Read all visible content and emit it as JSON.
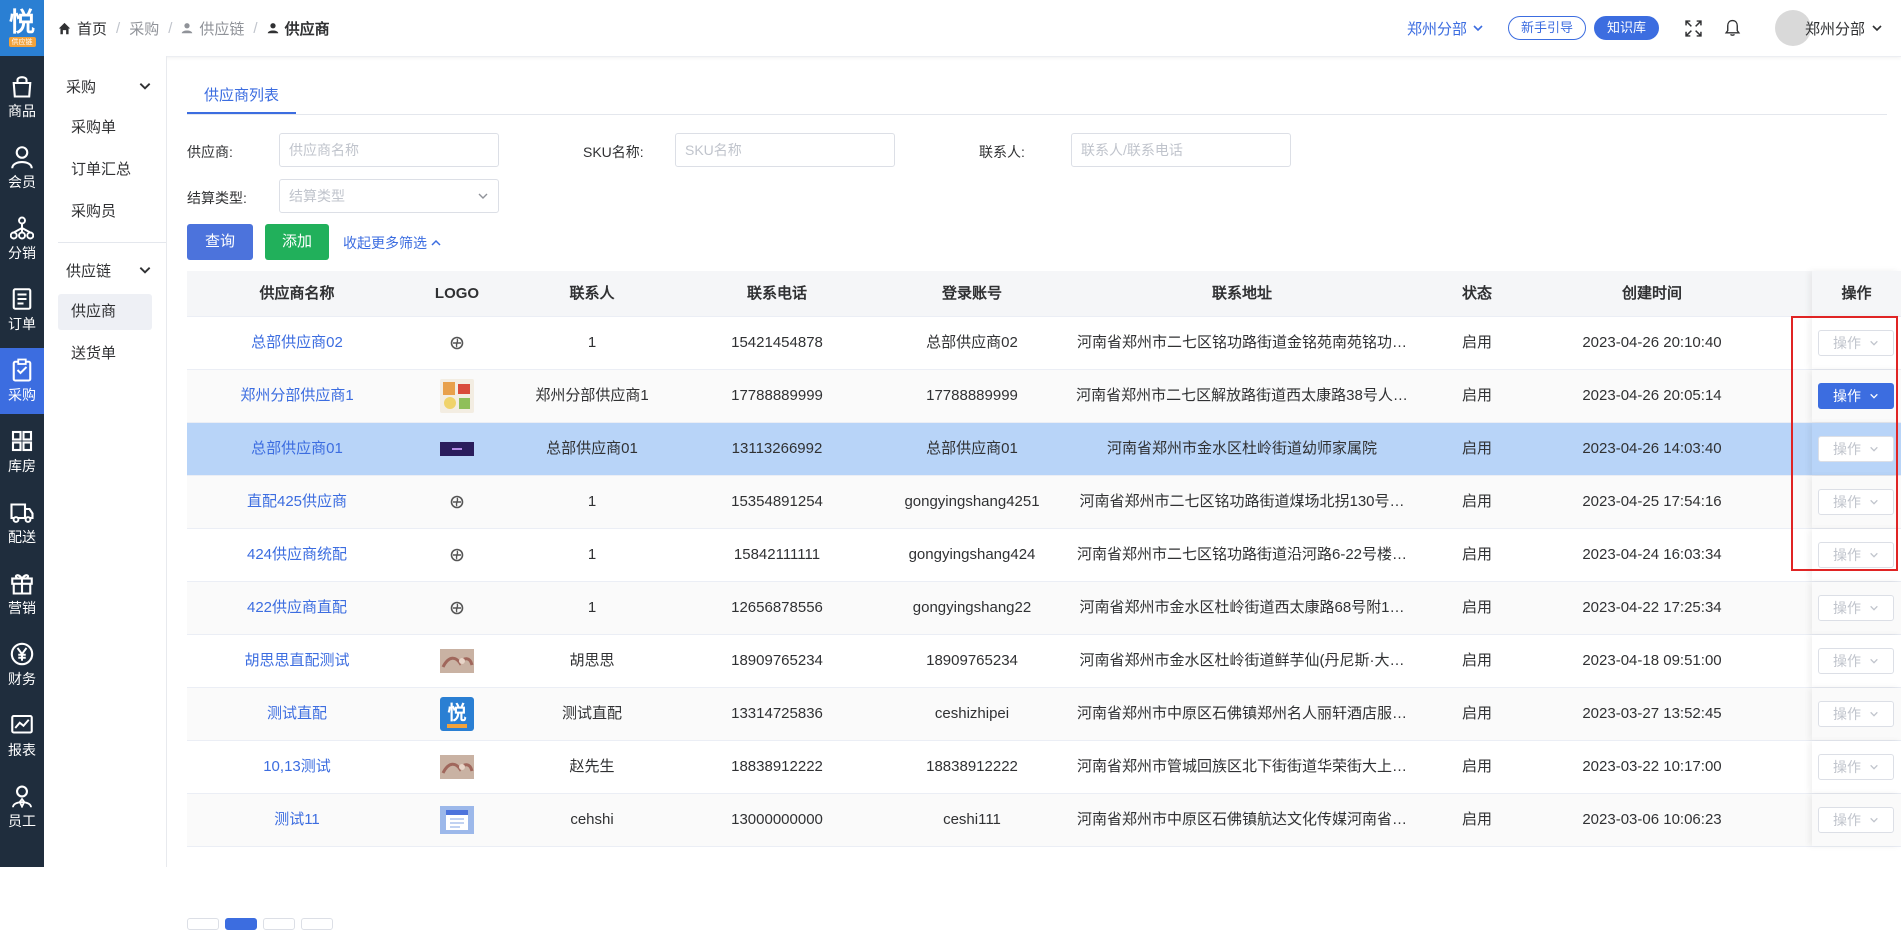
{
  "brand": {
    "logo_text": "悦",
    "logo_sub": "供应链"
  },
  "breadcrumb": [
    "首页",
    "采购",
    "供应链",
    "供应商"
  ],
  "header": {
    "branch": "郑州分部",
    "guide_label": "新手引导",
    "kb_label": "知识库",
    "user_name": "郑州分部"
  },
  "rail": [
    {
      "label": "商品",
      "icon": "bag-icon"
    },
    {
      "label": "会员",
      "icon": "user-icon"
    },
    {
      "label": "分销",
      "icon": "network-icon"
    },
    {
      "label": "订单",
      "icon": "document-icon"
    },
    {
      "label": "采购",
      "icon": "clipboard-icon",
      "active": true
    },
    {
      "label": "库房",
      "icon": "grid-icon"
    },
    {
      "label": "配送",
      "icon": "truck-icon"
    },
    {
      "label": "营销",
      "icon": "gift-icon"
    },
    {
      "label": "财务",
      "icon": "yen-icon"
    },
    {
      "label": "报表",
      "icon": "chart-icon"
    },
    {
      "label": "员工",
      "icon": "employee-icon"
    }
  ],
  "subnav": {
    "group1": "采购",
    "group1_items": [
      "采购单",
      "订单汇总",
      "采购员"
    ],
    "group2": "供应链",
    "group2_items": [
      "供应商",
      "送货单"
    ]
  },
  "tab_label": "供应商列表",
  "filters": {
    "supplier_label": "供应商:",
    "supplier_placeholder": "供应商名称",
    "sku_label": "SKU名称:",
    "sku_placeholder": "SKU名称",
    "contact_label": "联系人:",
    "contact_placeholder": "联系人/联系电话",
    "settle_label": "结算类型:",
    "settle_placeholder": "结算类型",
    "query_label": "查询",
    "add_label": "添加",
    "collapse_label": "收起更多筛选"
  },
  "table": {
    "columns": [
      "供应商名称",
      "LOGO",
      "联系人",
      "联系电话",
      "登录账号",
      "联系地址",
      "状态",
      "创建时间",
      "操作"
    ],
    "op_label": "操作",
    "rows": [
      {
        "name": "总部供应商02",
        "logo": "swirl",
        "contact": "1",
        "phone": "15421454878",
        "account": "总部供应商02",
        "address": "河南省郑州市二七区铭功路街道金铭苑南苑铭功…",
        "status": "启用",
        "created": "2023-04-26 20:10:40"
      },
      {
        "name": "郑州分部供应商1",
        "logo": "food",
        "contact": "郑州分部供应商1",
        "phone": "17788889999",
        "account": "17788889999",
        "address": "河南省郑州市二七区解放路街道西太康路38号人…",
        "status": "启用",
        "created": "2023-04-26 20:05:14",
        "op_active": true
      },
      {
        "name": "总部供应商01",
        "logo": "banner",
        "contact": "总部供应商01",
        "phone": "13113266992",
        "account": "总部供应商01",
        "address": "河南省郑州市金水区杜岭街道幼师家属院",
        "status": "启用",
        "created": "2023-04-26 14:03:40",
        "selected": true
      },
      {
        "name": "直配425供应商",
        "logo": "swirl",
        "contact": "1",
        "phone": "15354891254",
        "account": "gongyingshang4251",
        "address": "河南省郑州市二七区铭功路街道煤场北拐130号…",
        "status": "启用",
        "created": "2023-04-25 17:54:16"
      },
      {
        "name": "424供应商统配",
        "logo": "swirl",
        "contact": "1",
        "phone": "15842111111",
        "account": "gongyingshang424",
        "address": "河南省郑州市二七区铭功路街道沿河路6-22号楼…",
        "status": "启用",
        "created": "2023-04-24 16:03:34"
      },
      {
        "name": "422供应商直配",
        "logo": "swirl",
        "contact": "1",
        "phone": "12656878556",
        "account": "gongyingshang22",
        "address": "河南省郑州市金水区杜岭街道西太康路68号附1…",
        "status": "启用",
        "created": "2023-04-22 17:25:34"
      },
      {
        "name": "胡思思直配测试",
        "logo": "hands",
        "contact": "胡思思",
        "phone": "18909765234",
        "account": "18909765234",
        "address": "河南省郑州市金水区杜岭街道鲜芋仙(丹尼斯·大…",
        "status": "启用",
        "created": "2023-04-18 09:51:00"
      },
      {
        "name": "测试直配",
        "logo": "brand",
        "contact": "测试直配",
        "phone": "13314725836",
        "account": "ceshizhipei",
        "address": "河南省郑州市中原区石佛镇郑州名人丽轩酒店服…",
        "status": "启用",
        "created": "2023-03-27 13:52:45"
      },
      {
        "name": "10,13测试",
        "logo": "hands",
        "contact": "赵先生",
        "phone": "18838912222",
        "account": "18838912222",
        "address": "河南省郑州市管城回族区北下街街道华荣街大上…",
        "status": "启用",
        "created": "2023-03-22 10:17:00"
      },
      {
        "name": "测试11",
        "logo": "calendar",
        "contact": "cehshi",
        "phone": "13000000000",
        "account": "ceshi111",
        "address": "河南省郑州市中原区石佛镇航达文化传媒河南省…",
        "status": "启用",
        "created": "2023-03-06 10:06:23"
      }
    ]
  },
  "colors": {
    "accent": "#3c6de0",
    "rail": "#1f2d3d",
    "add": "#21b05b",
    "highlight": "#e02424",
    "selected_row": "#b8d4f8"
  }
}
